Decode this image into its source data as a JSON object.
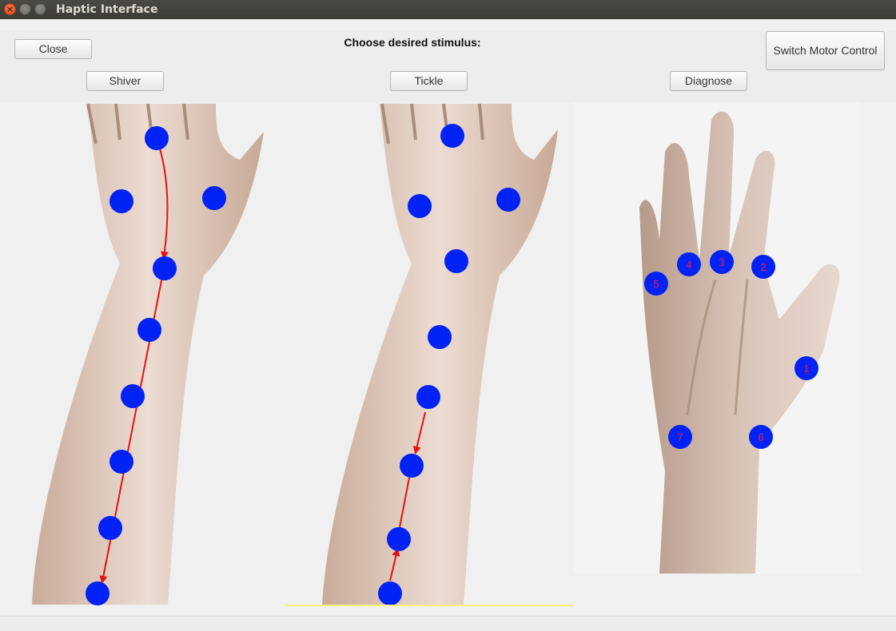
{
  "window": {
    "title": "Haptic Interface"
  },
  "toolbar": {
    "close_label": "Close",
    "heading": "Choose desired stimulus:",
    "switch_label": "Switch Motor Control",
    "shiver_label": "Shiver",
    "tickle_label": "Tickle",
    "diagnose_label": "Diagnose"
  },
  "colors": {
    "dot": "#0022f5",
    "arrow": "#e81212",
    "label": "#ff1a4a",
    "titlebar": "#3c3b37"
  },
  "diagnose": {
    "points": [
      {
        "label": "1"
      },
      {
        "label": "2"
      },
      {
        "label": "3"
      },
      {
        "label": "4"
      },
      {
        "label": "5"
      },
      {
        "label": "6"
      },
      {
        "label": "7"
      }
    ]
  }
}
